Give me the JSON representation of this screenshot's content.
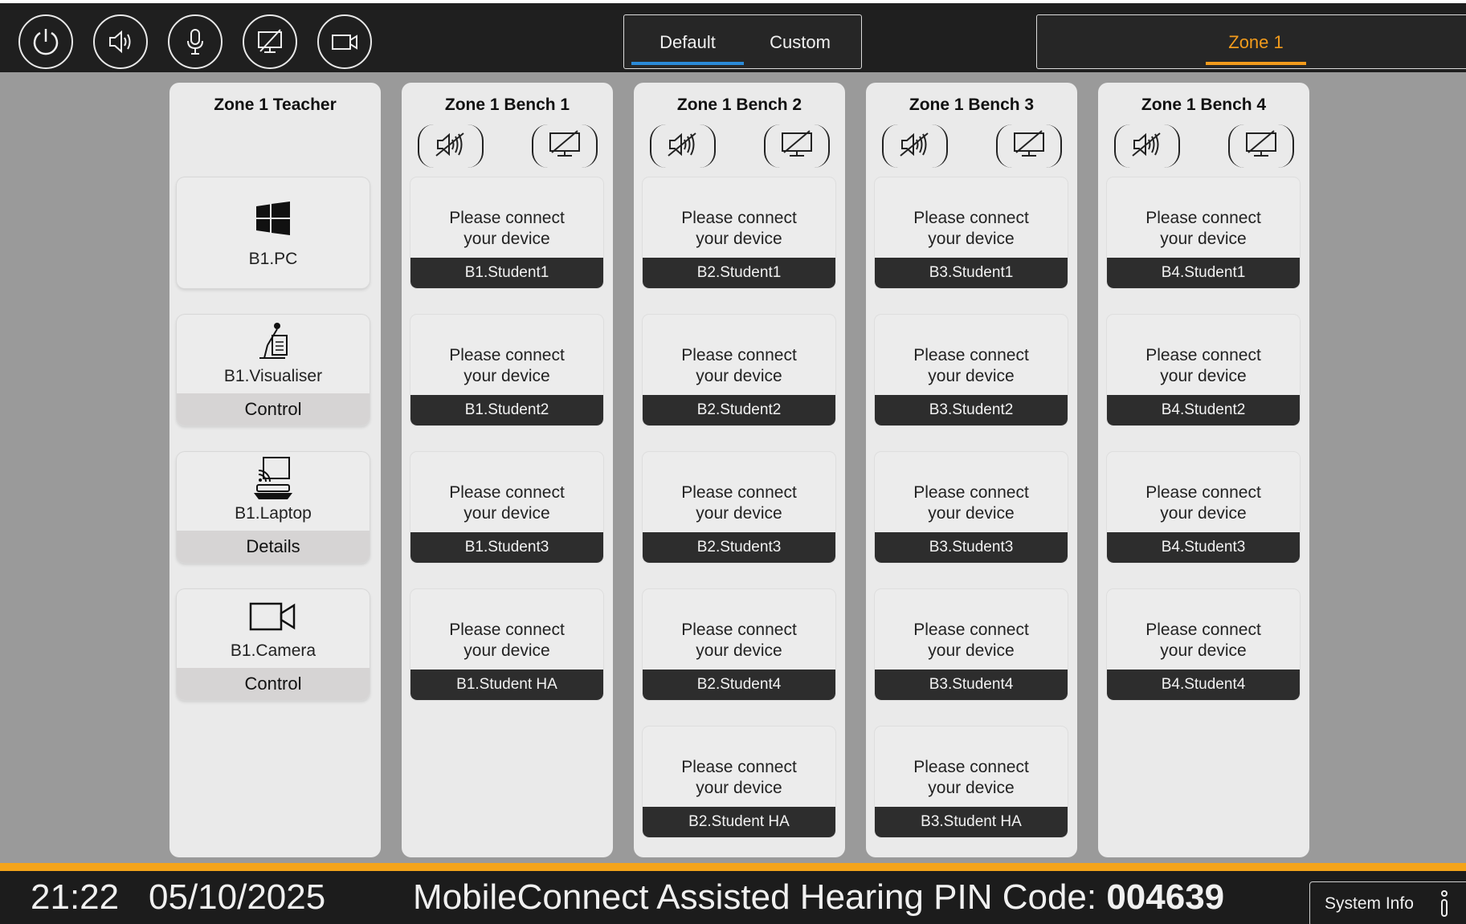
{
  "topbar": {
    "buttons": [
      {
        "icon": "power-icon"
      },
      {
        "icon": "speaker-icon"
      },
      {
        "icon": "microphone-icon"
      },
      {
        "icon": "display-off-icon"
      },
      {
        "icon": "camera-icon"
      }
    ],
    "mode_tabs": {
      "default": "Default",
      "custom": "Custom",
      "active": "Default"
    },
    "zone_tabs": {
      "zone1": "Zone 1",
      "active": "Zone 1"
    }
  },
  "teacher": {
    "title": "Zone 1 Teacher",
    "tiles": [
      {
        "icon": "windows-icon",
        "label": "B1.PC",
        "action": ""
      },
      {
        "icon": "visualiser-icon",
        "label": "B1.Visualiser",
        "action": "Control"
      },
      {
        "icon": "cast-laptop-icon",
        "label": "B1.Laptop",
        "action": "Details"
      },
      {
        "icon": "camera-icon",
        "label": "B1.Camera",
        "action": "Control"
      }
    ]
  },
  "prompt": {
    "line1": "Please connect",
    "line2": "your device"
  },
  "benches": [
    {
      "title": "Zone 1 Bench 1",
      "students": [
        "B1.Student1",
        "B1.Student2",
        "B1.Student3",
        "B1.Student HA"
      ]
    },
    {
      "title": "Zone 1 Bench 2",
      "students": [
        "B2.Student1",
        "B2.Student2",
        "B2.Student3",
        "B2.Student4",
        "B2.Student HA"
      ]
    },
    {
      "title": "Zone 1 Bench 3",
      "students": [
        "B3.Student1",
        "B3.Student2",
        "B3.Student3",
        "B3.Student4",
        "B3.Student HA"
      ]
    },
    {
      "title": "Zone 1 Bench 4",
      "students": [
        "B4.Student1",
        "B4.Student2",
        "B4.Student3",
        "B4.Student4"
      ]
    }
  ],
  "footer": {
    "time": "21:22",
    "date": "05/10/2025",
    "pin_label": "MobileConnect Assisted Hearing PIN Code: ",
    "pin_code": "004639",
    "system_info": "System Info"
  },
  "colors": {
    "accent_blue": "#2a8ad8",
    "accent_orange": "#f29b1c",
    "bar_dark": "#1f1f1f"
  }
}
